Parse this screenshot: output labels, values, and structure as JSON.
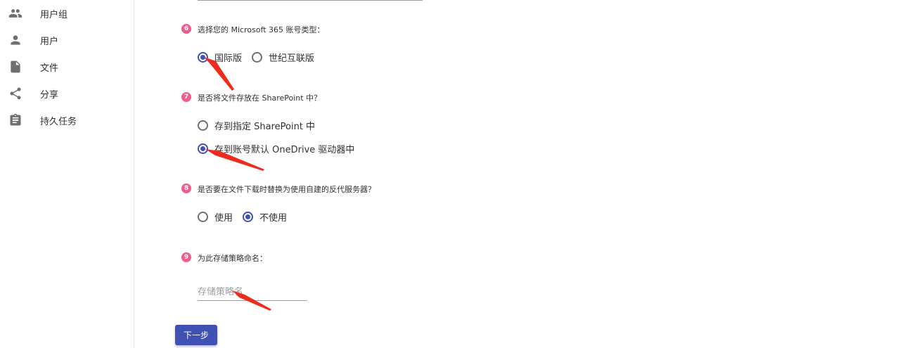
{
  "sidebar": {
    "items": [
      {
        "label": "用户组",
        "icon": "group-icon"
      },
      {
        "label": "用户",
        "icon": "person-icon"
      },
      {
        "label": "文件",
        "icon": "file-icon"
      },
      {
        "label": "分享",
        "icon": "share-icon"
      },
      {
        "label": "持久任务",
        "icon": "assignment-icon"
      }
    ]
  },
  "form": {
    "steps": [
      {
        "number": "6",
        "question": "选择您的 Microsoft 365 账号类型：",
        "options": [
          {
            "label": "国际版",
            "checked": true
          },
          {
            "label": "世纪互联版",
            "checked": false
          }
        ]
      },
      {
        "number": "7",
        "question": "是否将文件存放在 SharePoint 中？",
        "options": [
          {
            "label": "存到指定 SharePoint 中",
            "checked": false
          },
          {
            "label": "存到账号默认 OneDrive 驱动器中",
            "checked": true
          }
        ]
      },
      {
        "number": "8",
        "question": "是否要在文件下载时替换为使用自建的反代服务器？",
        "options": [
          {
            "label": "使用",
            "checked": false
          },
          {
            "label": "不使用",
            "checked": true
          }
        ]
      },
      {
        "number": "9",
        "question": "为此存储策略命名：",
        "input_placeholder": "存储策略名"
      }
    ],
    "next_label": "下一步"
  },
  "colors": {
    "primary": "#3f51b5",
    "step_badge": "#ef5d8d",
    "annotation_arrow": "#ee2b1d"
  }
}
